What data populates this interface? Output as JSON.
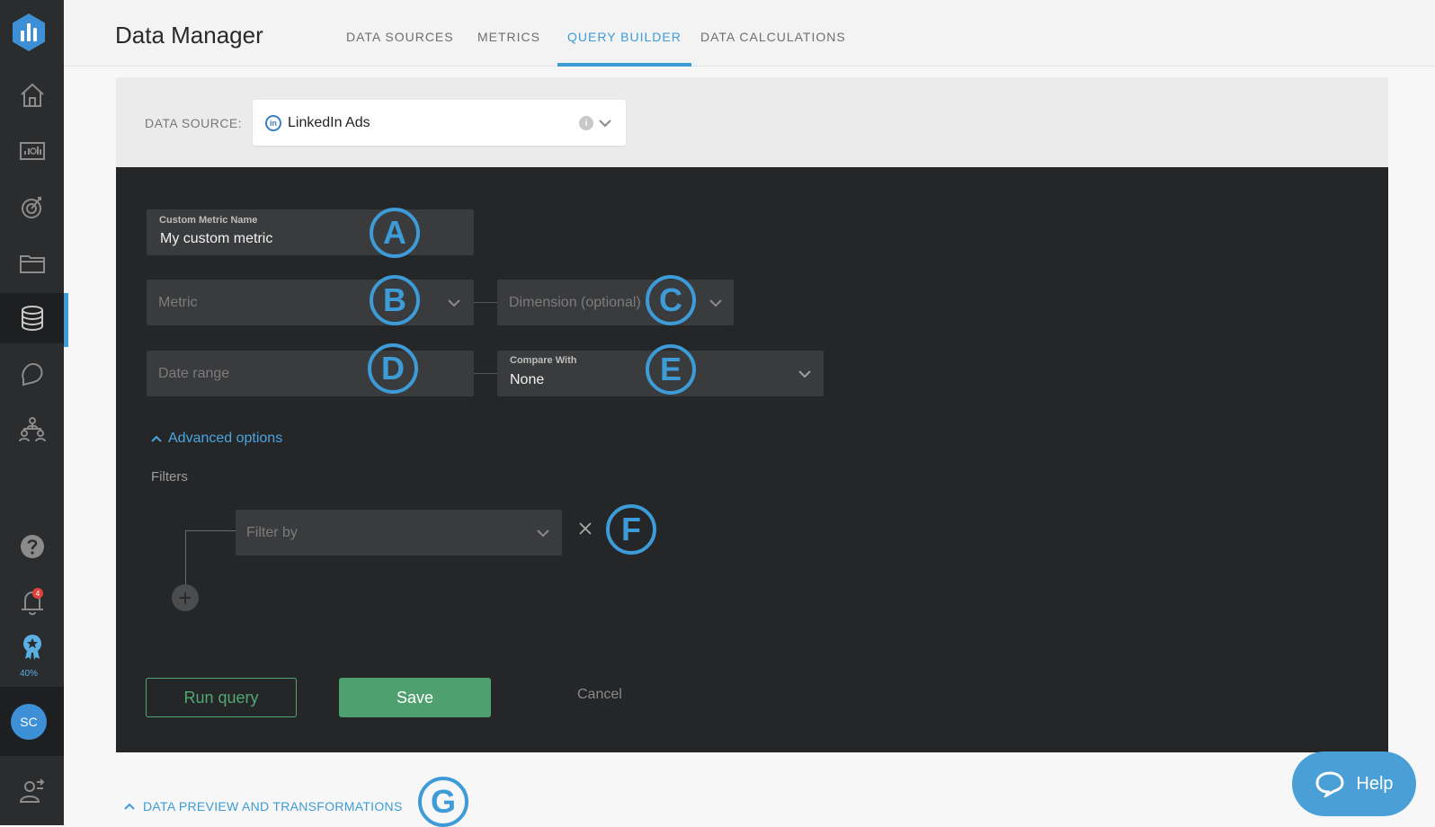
{
  "header": {
    "title": "Data Manager",
    "tabs": [
      {
        "label": "DATA SOURCES",
        "active": false
      },
      {
        "label": "METRICS",
        "active": false
      },
      {
        "label": "QUERY BUILDER",
        "active": true
      },
      {
        "label": "DATA CALCULATIONS",
        "active": false
      }
    ]
  },
  "sidebar": {
    "notification_count": "4",
    "progress_percent": "40%",
    "avatar_initials": "SC"
  },
  "data_source": {
    "label": "DATA SOURCE:",
    "value": "LinkedIn Ads",
    "icon_letters": "in"
  },
  "form": {
    "metric_name": {
      "label": "Custom Metric Name",
      "value": "My custom metric"
    },
    "metric": {
      "placeholder": "Metric"
    },
    "dimension": {
      "placeholder": "Dimension (optional)"
    },
    "date_range": {
      "placeholder": "Date range"
    },
    "compare_with": {
      "label": "Compare With",
      "value": "None"
    },
    "advanced_options": "Advanced options",
    "filters_label": "Filters",
    "filter_by": {
      "placeholder": "Filter by"
    },
    "add_filter_symbol": "+"
  },
  "actions": {
    "run_query": "Run query",
    "save": "Save",
    "cancel": "Cancel"
  },
  "markers": {
    "a": "A",
    "b": "B",
    "c": "C",
    "d": "D",
    "e": "E",
    "f": "F",
    "g": "G"
  },
  "preview": {
    "label": "DATA PREVIEW AND TRANSFORMATIONS"
  },
  "help": {
    "label": "Help"
  },
  "colors": {
    "accent": "#3d9bd8",
    "panel_bg": "#252628",
    "save_green": "#4fa06f",
    "sidebar_bg": "#2b2c2e"
  }
}
